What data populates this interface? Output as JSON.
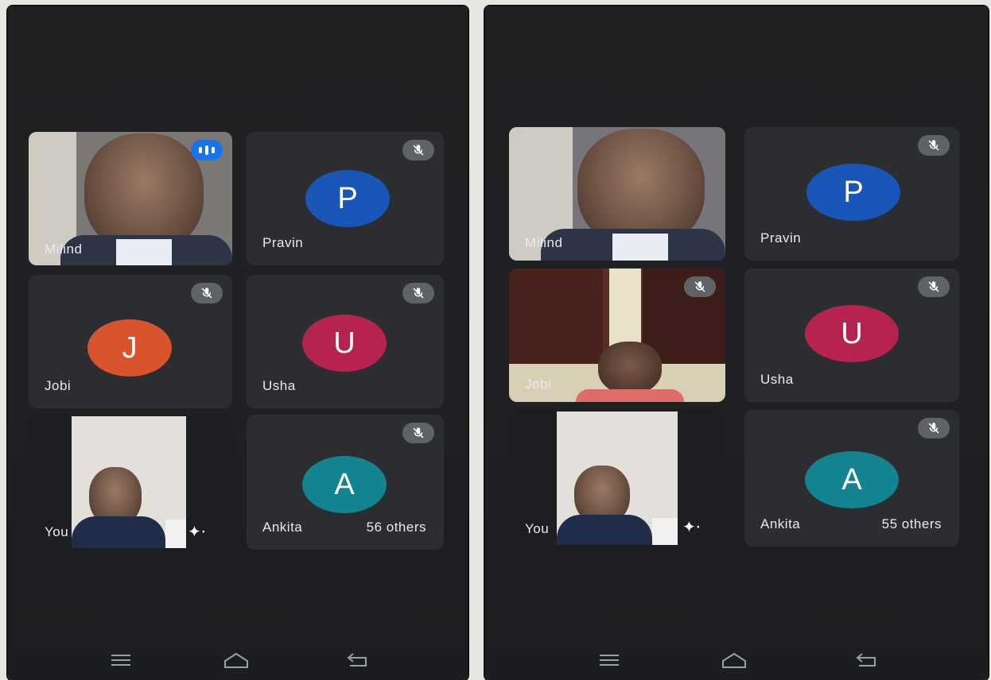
{
  "left_screen": {
    "tiles": [
      {
        "name": "Milind"
      },
      {
        "name": "Pravin",
        "initial": "P"
      },
      {
        "name": "Jobi",
        "initial": "J"
      },
      {
        "name": "Usha",
        "initial": "U"
      },
      {
        "name": "You"
      },
      {
        "name": "Ankita",
        "initial": "A",
        "others": "56 others"
      }
    ]
  },
  "right_screen": {
    "tiles": [
      {
        "name": "Milind"
      },
      {
        "name": "Pravin",
        "initial": "P"
      },
      {
        "name": "Jobi"
      },
      {
        "name": "Usha",
        "initial": "U"
      },
      {
        "name": "You"
      },
      {
        "name": "Ankita",
        "initial": "A",
        "others": "55 others"
      }
    ]
  },
  "colors": {
    "pravin": "#1a56b8",
    "jobi": "#d9532c",
    "usha": "#b7234f",
    "ankita": "#12838f",
    "speaking": "#1a73e8",
    "mute_chip": "#5f6368"
  },
  "icons": [
    "mic-off-icon",
    "speaking-indicator-icon",
    "visual-effects-icon",
    "menu-nav-icon",
    "home-nav-icon",
    "back-nav-icon"
  ]
}
